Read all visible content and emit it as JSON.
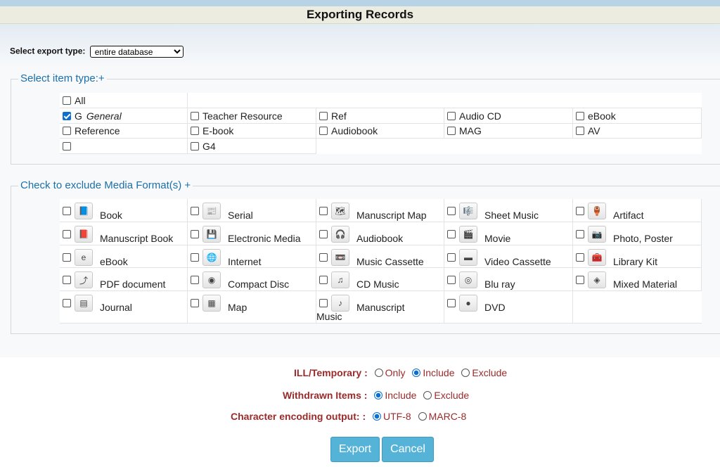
{
  "title": "Exporting Records",
  "export_type": {
    "label": "Select export type:",
    "selected": "entire database"
  },
  "item_section": {
    "legend": "Select item type:+",
    "all": "All",
    "general_code": "G",
    "general_name": "General",
    "items": [
      "Teacher Resource",
      "Ref",
      "Audio CD",
      "eBook",
      "Reference",
      "E-book",
      "Audiobook",
      "MAG",
      "AV",
      "",
      "G4"
    ]
  },
  "media_section": {
    "legend": "Check to exclude Media Format(s) +",
    "formats": [
      {
        "label": "Book",
        "icon": "book-icon"
      },
      {
        "label": "Serial",
        "icon": "serial-icon"
      },
      {
        "label": "Manuscript Map",
        "icon": "map-scroll-icon"
      },
      {
        "label": "Sheet Music",
        "icon": "sheet-music-icon"
      },
      {
        "label": "Artifact",
        "icon": "artifact-icon"
      },
      {
        "label": "Manuscript Book",
        "icon": "manuscript-book-icon"
      },
      {
        "label": "Electronic Media",
        "icon": "electronic-media-icon"
      },
      {
        "label": "Audiobook",
        "icon": "audiobook-icon"
      },
      {
        "label": "Movie",
        "icon": "movie-icon"
      },
      {
        "label": "Photo, Poster",
        "icon": "camera-icon"
      },
      {
        "label": "eBook",
        "icon": "ebook-icon"
      },
      {
        "label": "Internet",
        "icon": "internet-icon"
      },
      {
        "label": "Music Cassette",
        "icon": "cassette-icon"
      },
      {
        "label": "Video Cassette",
        "icon": "video-cassette-icon"
      },
      {
        "label": "Library Kit",
        "icon": "kit-icon"
      },
      {
        "label": "PDF document",
        "icon": "pdf-icon"
      },
      {
        "label": "Compact Disc",
        "icon": "compact-disc-icon"
      },
      {
        "label": "CD Music",
        "icon": "cd-music-icon"
      },
      {
        "label": "Blu ray",
        "icon": "blu-ray-icon"
      },
      {
        "label": "Mixed Material",
        "icon": "mixed-material-icon"
      },
      {
        "label": "Journal",
        "icon": "journal-icon"
      },
      {
        "label": "Map",
        "icon": "map-icon"
      },
      {
        "label": "Manuscript",
        "label2": "Music",
        "icon": "manuscript-music-icon"
      },
      {
        "label": "DVD",
        "icon": "dvd-icon"
      }
    ]
  },
  "options": {
    "ill_label": "ILL/Temporary :",
    "ill_values": [
      "Only",
      "Include",
      "Exclude"
    ],
    "ill_selected": "Include",
    "withdrawn_label": "Withdrawn Items :",
    "withdrawn_values": [
      "Include",
      "Exclude"
    ],
    "withdrawn_selected": "Include",
    "encoding_label": "Character encoding output: :",
    "encoding_values": [
      "UTF-8",
      "MARC-8"
    ],
    "encoding_selected": "UTF-8"
  },
  "buttons": {
    "export": "Export",
    "cancel": "Cancel"
  },
  "colors": {
    "accent": "#55b3d8",
    "legend": "#1d6fa8",
    "label_red": "#9b2a2a",
    "title_bg": "#ecece0"
  }
}
